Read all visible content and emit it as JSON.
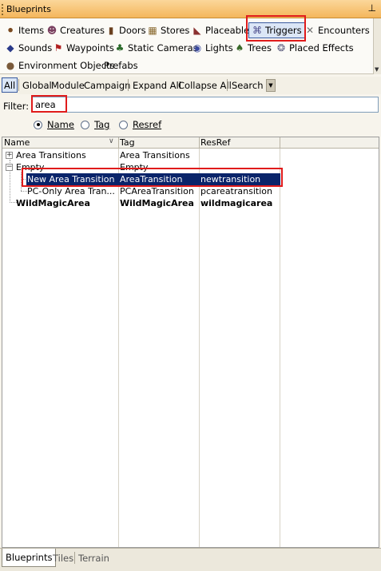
{
  "window": {
    "title": "Blueprints",
    "pin_glyph": "⊥"
  },
  "categories": [
    {
      "label": "Items",
      "icon": "items-icon",
      "glyph": "⚫",
      "color": "#7a4a20"
    },
    {
      "label": "Creatures",
      "icon": "creatures-icon",
      "glyph": "☻",
      "color": "#7a4060"
    },
    {
      "label": "Doors",
      "icon": "doors-icon",
      "glyph": "▮",
      "color": "#6a4020"
    },
    {
      "label": "Stores",
      "icon": "stores-icon",
      "glyph": "▦",
      "color": "#8a6a30"
    },
    {
      "label": "Placeables",
      "icon": "placeables-icon",
      "glyph": "◣",
      "color": "#8a3030"
    },
    {
      "label": "Triggers",
      "icon": "triggers-icon",
      "glyph": "⌘",
      "color": "#4a4a8a"
    },
    {
      "label": "Encounters",
      "icon": "encounters-icon",
      "glyph": "✕",
      "color": "#707070"
    },
    {
      "label": "Sounds",
      "icon": "sounds-icon",
      "glyph": "◆",
      "color": "#2a3a8a"
    },
    {
      "label": "Waypoints",
      "icon": "waypoints-icon",
      "glyph": "⚑",
      "color": "#b02020"
    },
    {
      "label": "Static Cameras",
      "icon": "static-cameras-icon",
      "glyph": "♣",
      "color": "#2a6a2a"
    },
    {
      "label": "Lights",
      "icon": "lights-icon",
      "glyph": "◉",
      "color": "#3a4aa0"
    },
    {
      "label": "Trees",
      "icon": "trees-icon",
      "glyph": "♠",
      "color": "#3a6a2a"
    },
    {
      "label": "Placed Effects",
      "icon": "placed-effects-icon",
      "glyph": "❂",
      "color": "#606080"
    },
    {
      "label": "Environment Objects",
      "icon": "environment-objects-icon",
      "glyph": "●",
      "color": "#7a5a3a"
    },
    {
      "label": "Prefabs",
      "icon": "",
      "glyph": "",
      "color": ""
    }
  ],
  "active_category": "Triggers",
  "scope": {
    "all": "All",
    "global": "Global",
    "module": "Module",
    "campaign": "Campaign",
    "expand_all": "Expand All",
    "collapse_all": "Collapse All",
    "search": "Search"
  },
  "filter": {
    "label": "Filter:",
    "value": "area"
  },
  "search_by": {
    "name": "Name",
    "tag": "Tag",
    "resref": "Resref",
    "selected": "Name"
  },
  "tree": {
    "columns": [
      "Name",
      "Tag",
      "ResRef"
    ],
    "rows": [
      {
        "name": "Area Transitions",
        "tag": "Area Transitions",
        "resref": "",
        "expander": "+"
      },
      {
        "name": "Empty",
        "tag": "Empty",
        "resref": "",
        "expander": "−"
      },
      {
        "name": "New Area Transition",
        "tag": "AreaTransition",
        "resref": "newtransition",
        "selected": true
      },
      {
        "name": "PC-Only Area Tran...",
        "tag": "PCAreaTransition",
        "resref": "pcareatransition"
      },
      {
        "name": "WildMagicArea",
        "tag": "WildMagicArea",
        "resref": "wildmagicarea",
        "bold": true
      }
    ]
  },
  "bottom_tabs": [
    "Blueprints",
    "Tiles",
    "Terrain"
  ],
  "accent_colors": {
    "selection": "#0a246a",
    "annotation": "#e01b1b",
    "titlebar": "#f4b65c"
  }
}
